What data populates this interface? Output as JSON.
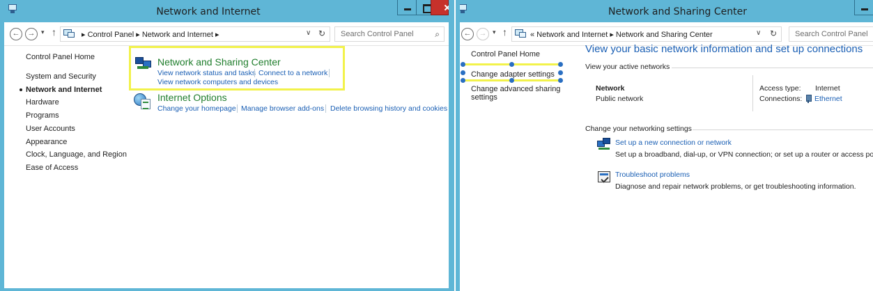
{
  "left_window": {
    "title": "Network and Internet",
    "nav": {
      "back": "←",
      "forward": "→",
      "recent": "▾",
      "up": "↑"
    },
    "breadcrumb": "▸ Control Panel ▸ Network and Internet ▸",
    "address_dropdown": "∨",
    "refresh": "↻",
    "search_placeholder": "Search Control Panel",
    "search_icon": "⌕",
    "sidebar": {
      "home": "Control Panel Home",
      "items": [
        {
          "label": "System and Security",
          "current": false
        },
        {
          "label": "Network and Internet",
          "current": true
        },
        {
          "label": "Hardware",
          "current": false
        },
        {
          "label": "Programs",
          "current": false
        },
        {
          "label": "User Accounts",
          "current": false
        },
        {
          "label": "Appearance",
          "current": false
        },
        {
          "label": "Clock, Language, and Region",
          "current": false
        },
        {
          "label": "Ease of Access",
          "current": false
        }
      ]
    },
    "categories": [
      {
        "title": "Network and Sharing Center",
        "icon": "network-sharing-icon",
        "tasks": [
          "View network status and tasks",
          "Connect to a network",
          "View network computers and devices"
        ]
      },
      {
        "title": "Internet Options",
        "icon": "internet-options-icon",
        "tasks": [
          "Change your homepage",
          "Manage browser add-ons",
          "Delete browsing history and cookies"
        ]
      }
    ]
  },
  "right_window": {
    "title": "Network and Sharing Center",
    "nav": {
      "back": "←",
      "forward": "→",
      "recent": "▾",
      "up": "↑"
    },
    "breadcrumb": "«  Network and Internet  ▸  Network and Sharing Center",
    "address_dropdown": "∨",
    "refresh": "↻",
    "search_placeholder": "Search Control Panel",
    "sidebar": {
      "home": "Control Panel Home",
      "links": [
        "Change adapter settings",
        "Change advanced sharing",
        "settings"
      ]
    },
    "heading": "View your basic network information and set up connections",
    "active_networks": {
      "section_title": "View your active networks",
      "network_name": "Network",
      "network_type": "Public network",
      "access_type_label": "Access type:",
      "access_type_value": "Internet",
      "connections_label": "Connections:",
      "connections_value": "Ethernet"
    },
    "networking_settings": {
      "section_title": "Change your networking settings",
      "items": [
        {
          "link": "Set up a new connection or network",
          "description": "Set up a broadband, dial-up, or VPN connection; or set up a router or access point."
        },
        {
          "link": "Troubleshoot problems",
          "description": "Diagnose and repair network problems, or get troubleshooting information."
        }
      ]
    }
  },
  "colors": {
    "title_bar": "#5fb6d6",
    "close_button": "#c7312b",
    "link_blue": "#1a5fb4",
    "category_green": "#1f7d2c",
    "highlight_yellow": "#f2f24a"
  }
}
